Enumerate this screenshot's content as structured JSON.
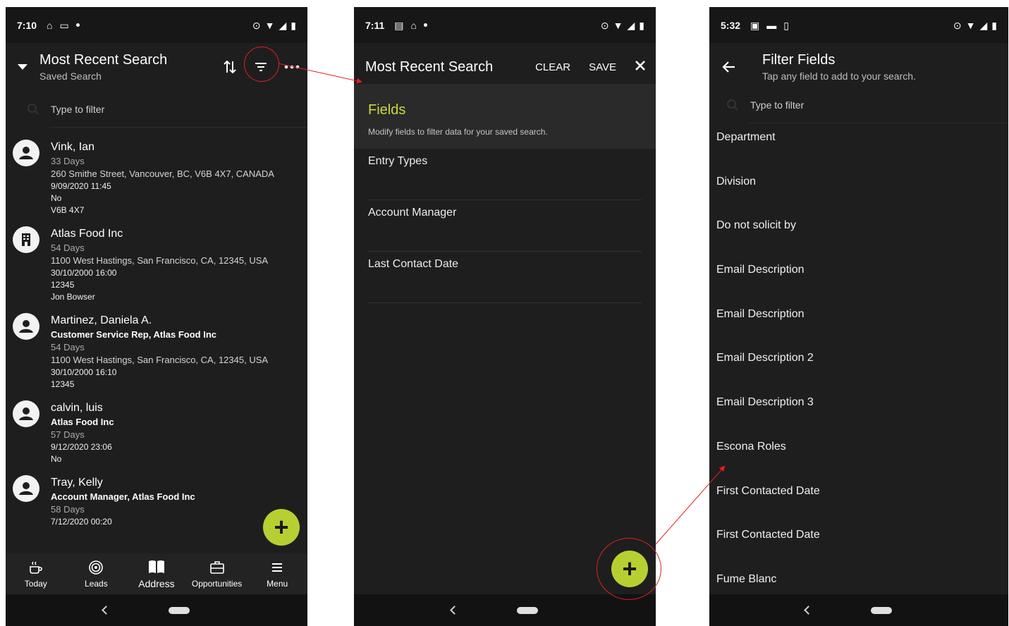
{
  "screen1": {
    "status": {
      "time": "7:10"
    },
    "appbar": {
      "title": "Most Recent Search",
      "subtitle": "Saved Search"
    },
    "search": {
      "placeholder": "Type to filter"
    },
    "items": [
      {
        "icon": "person-icon",
        "name": "Vink, Ian",
        "lines": [
          {
            "text": "33 Days",
            "style": "grey"
          },
          {
            "text": "260 Smithe Street, Vancouver, BC, V6B 4X7, CANADA",
            "style": "addr"
          },
          {
            "text": "9/09/2020 11:45",
            "style": "small"
          },
          {
            "text": "No",
            "style": "small"
          },
          {
            "text": "V6B 4X7",
            "style": "small"
          }
        ]
      },
      {
        "icon": "building-icon",
        "name": "Atlas Food Inc",
        "lines": [
          {
            "text": "54 Days",
            "style": "grey"
          },
          {
            "text": "1100 West Hastings, San Francisco, CA, 12345, USA",
            "style": "addr"
          },
          {
            "text": "30/10/2000 16:00",
            "style": "small"
          },
          {
            "text": "12345",
            "style": "small"
          },
          {
            "text": "Jon Bowser",
            "style": "small"
          }
        ]
      },
      {
        "icon": "person-icon",
        "name": "Martinez, Daniela A.",
        "lines": [
          {
            "text": "Customer Service Rep, Atlas Food Inc",
            "style": "bold"
          },
          {
            "text": "54 Days",
            "style": "grey"
          },
          {
            "text": "1100 West Hastings, San Francisco, CA, 12345, USA",
            "style": "addr"
          },
          {
            "text": "30/10/2000 16:10",
            "style": "small"
          },
          {
            "text": "12345",
            "style": "small"
          }
        ]
      },
      {
        "icon": "person-icon",
        "name": "calvin, luis",
        "lines": [
          {
            "text": "Atlas Food Inc",
            "style": "bold"
          },
          {
            "text": "57 Days",
            "style": "grey"
          },
          {
            "text": "9/12/2020 23:06",
            "style": "small"
          },
          {
            "text": "No",
            "style": "small"
          }
        ]
      },
      {
        "icon": "person-icon",
        "name": "Tray, Kelly",
        "lines": [
          {
            "text": "Account Manager, Atlas Food Inc",
            "style": "bold"
          },
          {
            "text": "58 Days",
            "style": "grey"
          },
          {
            "text": "7/12/2020 00:20",
            "style": "small"
          }
        ]
      }
    ],
    "nav": [
      {
        "label": "Today",
        "icon": "coffee-icon"
      },
      {
        "label": "Leads",
        "icon": "target-icon"
      },
      {
        "label": "Address",
        "icon": "book-icon"
      },
      {
        "label": "Opportunities",
        "icon": "briefcase-icon"
      },
      {
        "label": "Menu",
        "icon": "menu-icon"
      }
    ]
  },
  "screen2": {
    "status": {
      "time": "7:11"
    },
    "appbar": {
      "title": "Most Recent Search",
      "clear": "CLEAR",
      "save": "SAVE"
    },
    "fields": {
      "heading": "Fields",
      "subtitle": "Modify fields to filter data for your saved search."
    },
    "rows": [
      "Entry Types",
      "Account Manager",
      "Last Contact Date"
    ]
  },
  "screen3": {
    "status": {
      "time": "5:32"
    },
    "appbar": {
      "title": "Filter Fields",
      "subtitle": "Tap any field to add to your search."
    },
    "search": {
      "placeholder": "Type to filter"
    },
    "fields": [
      "Department",
      "Division",
      "Do not solicit by",
      "Email Description",
      "Email Description",
      "Email Description 2",
      "Email Description 3",
      "Escona Roles",
      "First Contacted Date",
      "First Contacted Date",
      "Fume Blanc"
    ]
  },
  "colors": {
    "accent": "#b8cf32",
    "fields_heading": "#c8da3c",
    "highlight": "#e02020",
    "background": "#1e1e1e"
  }
}
